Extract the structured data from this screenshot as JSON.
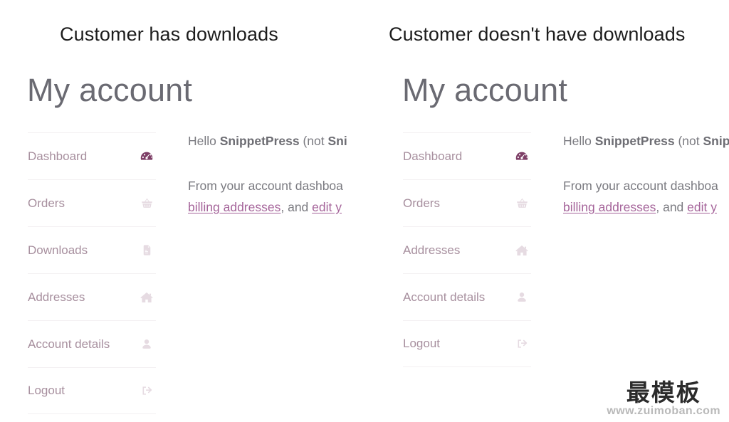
{
  "captions": {
    "left": "Customer has downloads",
    "right": "Customer doesn't have downloads"
  },
  "panel_left": {
    "title": "My account",
    "nav": [
      {
        "label": "Dashboard",
        "icon": "speedometer-icon",
        "active": true
      },
      {
        "label": "Orders",
        "icon": "basket-icon",
        "active": false
      },
      {
        "label": "Downloads",
        "icon": "file-download-icon",
        "active": false
      },
      {
        "label": "Addresses",
        "icon": "home-icon",
        "active": false
      },
      {
        "label": "Account details",
        "icon": "user-icon",
        "active": false
      },
      {
        "label": "Logout",
        "icon": "sign-out-icon",
        "active": false
      }
    ],
    "content": {
      "hello_prefix": "Hello ",
      "hello_user": "SnippetPress",
      "hello_middle": " (not ",
      "hello_logout_link": "Sni",
      "para_start": "From your account dashboa",
      "link_billing": "billing addresses",
      "para_mid": ", and ",
      "link_edit": "edit y"
    }
  },
  "panel_right": {
    "title": "My account",
    "nav": [
      {
        "label": "Dashboard",
        "icon": "speedometer-icon",
        "active": true
      },
      {
        "label": "Orders",
        "icon": "basket-icon",
        "active": false
      },
      {
        "label": "Addresses",
        "icon": "home-icon",
        "active": false
      },
      {
        "label": "Account details",
        "icon": "user-icon",
        "active": false
      },
      {
        "label": "Logout",
        "icon": "sign-out-icon",
        "active": false
      }
    ],
    "content": {
      "hello_prefix": "Hello ",
      "hello_user": "SnippetPress",
      "hello_middle": " (not ",
      "hello_logout_link": "Snip",
      "para_start": "From your account dashboa",
      "link_billing": "billing addresses",
      "para_mid": ", and ",
      "link_edit": "edit y"
    }
  },
  "watermark": {
    "text_cn": "最模板",
    "url": "www.zuimoban.com"
  },
  "colors": {
    "caption": "#1d1d1d",
    "title": "#6a6a72",
    "nav_label": "#a78f9e",
    "icon_pale": "#e6dbe2",
    "icon_active": "#7e3f67",
    "link": "#a5649a",
    "body_text": "#7a7a80",
    "divider": "#f3f0f2",
    "background": "#ffffff"
  }
}
